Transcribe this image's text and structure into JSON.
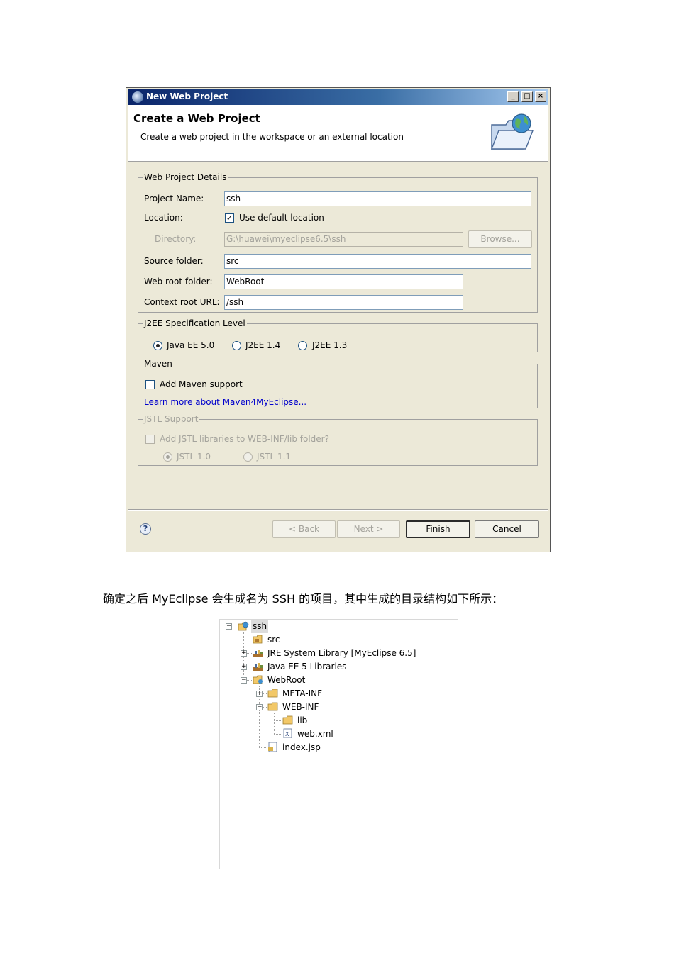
{
  "window": {
    "title": "New Web Project",
    "heading": "Create a Web Project",
    "description": "Create a web project in the workspace or an external location",
    "controls": {
      "minimize": "_",
      "maximize": "□",
      "close": "×"
    }
  },
  "details": {
    "legend": "Web Project Details",
    "project_name_label": "Project Name:",
    "project_name_value": "ssh",
    "location_label": "Location:",
    "use_default_label": "Use default location",
    "use_default_checked": true,
    "directory_label": "Directory:",
    "directory_value": "G:\\huawei\\myeclipse6.5\\ssh",
    "browse_label": "Browse...",
    "source_folder_label": "Source folder:",
    "source_folder_value": "src",
    "web_root_label": "Web root folder:",
    "web_root_value": "WebRoot",
    "context_root_label": "Context root URL:",
    "context_root_value": "/ssh"
  },
  "j2ee": {
    "legend": "J2EE Specification Level",
    "options": [
      "Java EE 5.0",
      "J2EE 1.4",
      "J2EE 1.3"
    ],
    "selected": "Java EE 5.0"
  },
  "maven": {
    "legend": "Maven",
    "add_support_label": "Add Maven support",
    "link_label": "Learn more about Maven4MyEclipse..."
  },
  "jstl": {
    "legend": "JSTL Support",
    "add_libraries_label": "Add JSTL libraries to WEB-INF/lib folder?",
    "options": [
      "JSTL 1.0",
      "JSTL 1.1"
    ],
    "selected": "JSTL 1.0"
  },
  "buttons": {
    "help": "?",
    "back": "< Back",
    "next": "Next >",
    "finish": "Finish",
    "cancel": "Cancel"
  },
  "caption": "确定之后 MyEclipse 会生成名为 SSH 的项目，其中生成的目录结构如下所示：",
  "tree": {
    "root": "ssh",
    "src": "src",
    "jre_library": "JRE System Library [MyEclipse 6.5]",
    "javaee_libraries": "Java EE 5 Libraries",
    "webroot": "WebRoot",
    "meta_inf": "META-INF",
    "web_inf": "WEB-INF",
    "lib": "lib",
    "web_xml": "web.xml",
    "index_jsp": "index.jsp",
    "expanders": {
      "collapsed": "+",
      "expanded": "−"
    }
  },
  "colors": {
    "titlebar": "#0a246a",
    "dialog_bg": "#ece9d8",
    "link": "#0000cc",
    "folder": "#f2c868"
  }
}
